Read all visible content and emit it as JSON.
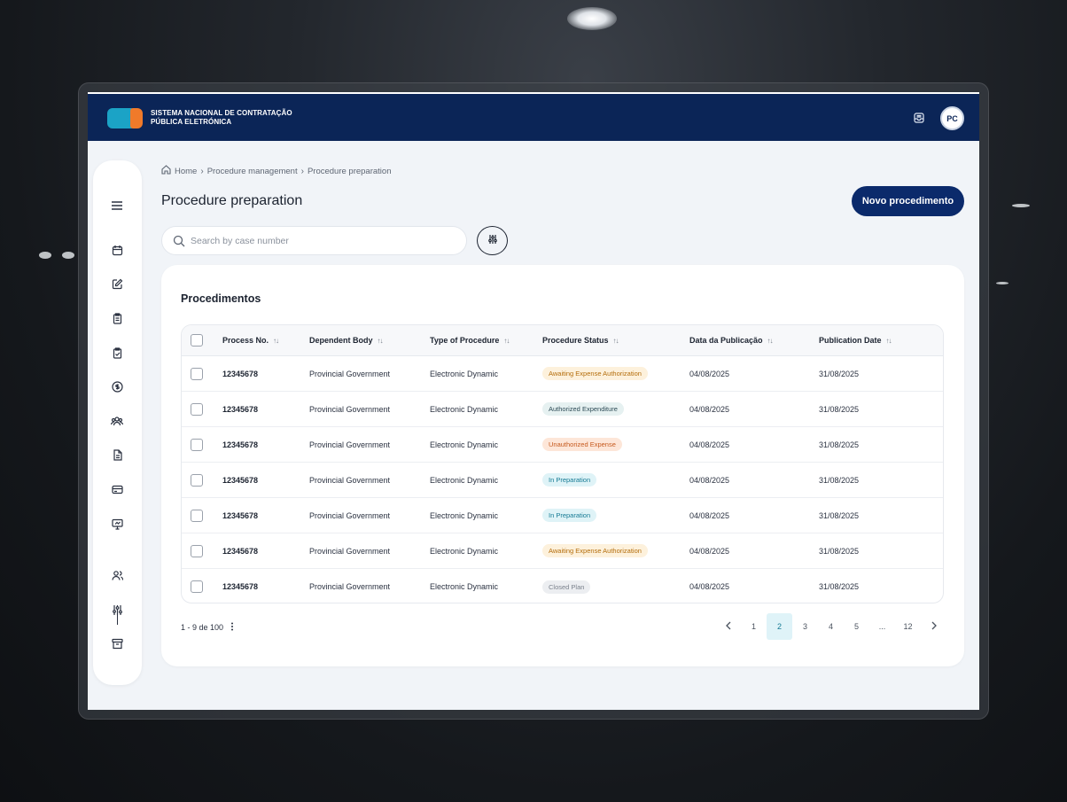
{
  "app": {
    "logo_line1": "SISTEMA NACIONAL DE CONTRATAÇÃO",
    "logo_line2": "PÚBLICA ELETRÓNICA",
    "user_initials": "PC"
  },
  "breadcrumb": [
    "Home",
    "Procedure management",
    "Procedure preparation"
  ],
  "page": {
    "title": "Procedure preparation",
    "primary_action": "Novo procedimento"
  },
  "search": {
    "placeholder": "Search by case number"
  },
  "card": {
    "title": "Procedimentos"
  },
  "table": {
    "columns": [
      "Process No.",
      "Dependent Body",
      "Type of Procedure",
      "Procedure Status",
      "Data da Publicação",
      "Publication Date"
    ],
    "rows": [
      {
        "process": "12345678",
        "body": "Provincial Government",
        "type": "Electronic Dynamic",
        "status": "Awaiting Expense Authorization",
        "status_kind": "await",
        "data_pub": "04/08/2025",
        "pub_date": "31/08/2025"
      },
      {
        "process": "12345678",
        "body": "Provincial Government",
        "type": "Electronic Dynamic",
        "status": "Authorized Expenditure",
        "status_kind": "auth",
        "data_pub": "04/08/2025",
        "pub_date": "31/08/2025"
      },
      {
        "process": "12345678",
        "body": "Provincial Government",
        "type": "Electronic Dynamic",
        "status": "Unauthorized Expense",
        "status_kind": "unauth",
        "data_pub": "04/08/2025",
        "pub_date": "31/08/2025"
      },
      {
        "process": "12345678",
        "body": "Provincial Government",
        "type": "Electronic Dynamic",
        "status": "In Preparation",
        "status_kind": "prep",
        "data_pub": "04/08/2025",
        "pub_date": "31/08/2025"
      },
      {
        "process": "12345678",
        "body": "Provincial Government",
        "type": "Electronic Dynamic",
        "status": "In Preparation",
        "status_kind": "prep",
        "data_pub": "04/08/2025",
        "pub_date": "31/08/2025"
      },
      {
        "process": "12345678",
        "body": "Provincial Government",
        "type": "Electronic Dynamic",
        "status": "Awaiting Expense Authorization",
        "status_kind": "await",
        "data_pub": "04/08/2025",
        "pub_date": "31/08/2025"
      },
      {
        "process": "12345678",
        "body": "Provincial Government",
        "type": "Electronic Dynamic",
        "status": "Closed Plan",
        "status_kind": "closed",
        "data_pub": "04/08/2025",
        "pub_date": "31/08/2025"
      }
    ]
  },
  "pagination": {
    "range_text": "1 - 9 de 100",
    "pages": [
      "1",
      "2",
      "3",
      "4",
      "5",
      "...",
      "12"
    ],
    "active_page": "2"
  },
  "colors": {
    "topbar": "#0b2557",
    "primary": "#0b2a6b",
    "logo_blue": "#1ba3c6",
    "logo_orange": "#f07a2a"
  },
  "icons": {
    "sidebar": [
      "menu-icon",
      "calendar-icon",
      "edit-icon",
      "clipboard-icon",
      "clipboard-check-icon",
      "dollar-icon",
      "users-group-icon",
      "document-icon",
      "card-icon",
      "presentation-icon",
      "user-icon",
      "sliders-icon",
      "archive-icon"
    ]
  }
}
